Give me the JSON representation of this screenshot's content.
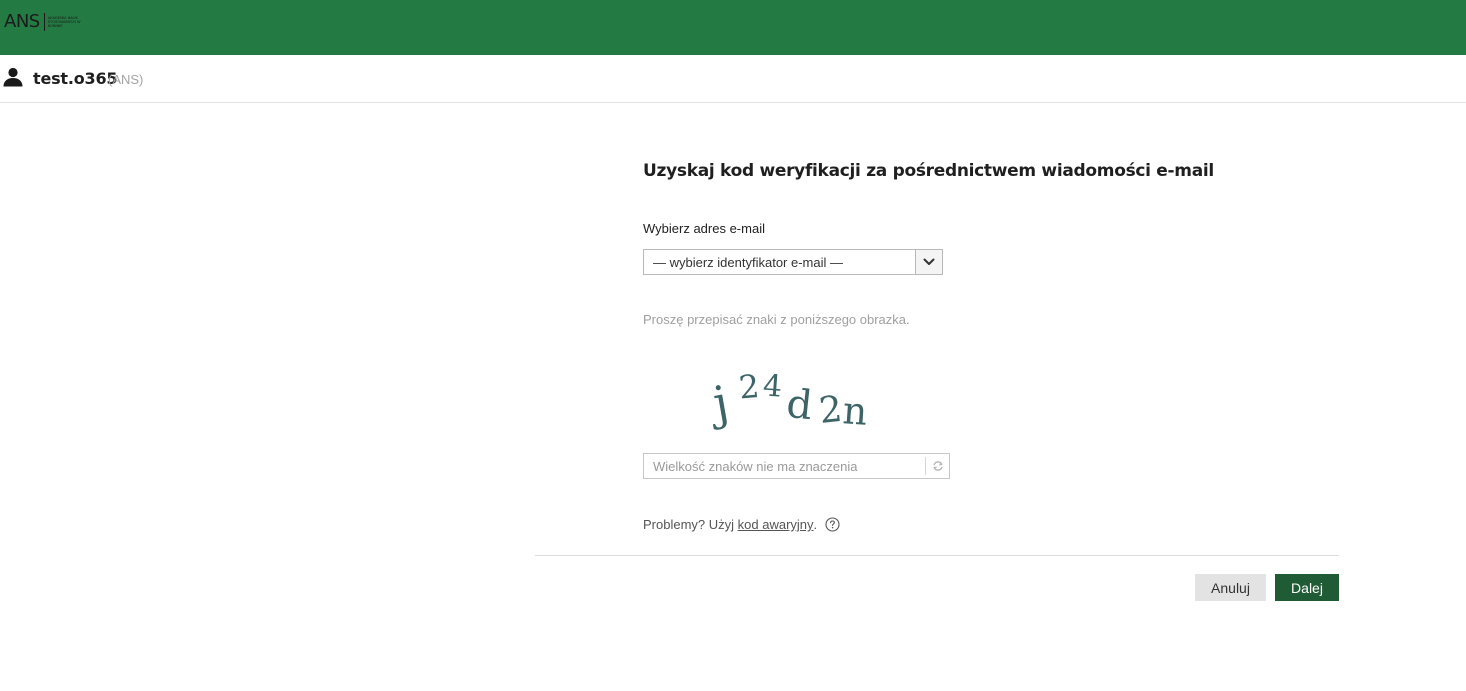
{
  "header": {
    "logo_mark": "ANS",
    "logo_subtext": "AKADEMIA NAUK STOSOWANYCH W KONINIE",
    "background_color": "#247a43"
  },
  "user": {
    "icon": "user-icon",
    "name": "test.o365",
    "org": "(ANS)"
  },
  "form": {
    "title": "Uzyskaj kod weryfikacji za pośrednictwem wiadomości e-mail",
    "email_select": {
      "label": "Wybierz adres e-mail",
      "selected": "— wybierz identyfikator e-mail —",
      "icon": "chevron-down-icon"
    },
    "captcha": {
      "instruction": "Proszę przepisać znaki z poniższego obrazka.",
      "image_text": "j24d2n",
      "input_placeholder": "Wielkość znaków nie ma znaczenia",
      "input_value": "",
      "refresh_icon": "refresh-icon"
    },
    "problems": {
      "text": "Problemy? Użyj",
      "link": "kod awaryjny",
      "suffix": ".",
      "help_icon": "help-icon"
    }
  },
  "actions": {
    "cancel_label": "Anuluj",
    "next_label": "Dalej",
    "cancel_color": "#e3e3e3",
    "next_color": "#1f5b35"
  }
}
